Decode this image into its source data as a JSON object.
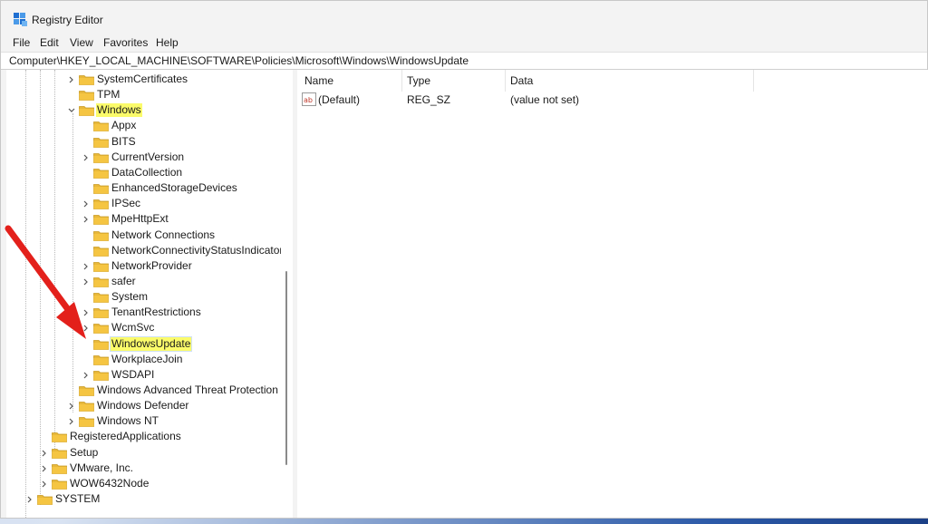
{
  "window": {
    "title": "Registry Editor"
  },
  "menu": [
    "File",
    "Edit",
    "View",
    "Favorites",
    "Help"
  ],
  "address": "Computer\\HKEY_LOCAL_MACHINE\\SOFTWARE\\Policies\\Microsoft\\Windows\\WindowsUpdate",
  "tree": [
    {
      "label": "SystemCertificates",
      "expander": "collapsed"
    },
    {
      "label": "TPM",
      "expander": "none"
    },
    {
      "label": "Windows",
      "expander": "expanded",
      "highlight": true
    },
    {
      "label": "Appx",
      "expander": "none"
    },
    {
      "label": "BITS",
      "expander": "none"
    },
    {
      "label": "CurrentVersion",
      "expander": "collapsed"
    },
    {
      "label": "DataCollection",
      "expander": "none"
    },
    {
      "label": "EnhancedStorageDevices",
      "expander": "none"
    },
    {
      "label": "IPSec",
      "expander": "collapsed"
    },
    {
      "label": "MpeHttpExt",
      "expander": "collapsed"
    },
    {
      "label": "Network Connections",
      "expander": "none"
    },
    {
      "label": "NetworkConnectivityStatusIndicator",
      "expander": "none"
    },
    {
      "label": "NetworkProvider",
      "expander": "collapsed"
    },
    {
      "label": "safer",
      "expander": "collapsed"
    },
    {
      "label": "System",
      "expander": "none"
    },
    {
      "label": "TenantRestrictions",
      "expander": "collapsed"
    },
    {
      "label": "WcmSvc",
      "expander": "collapsed"
    },
    {
      "label": "WindowsUpdate",
      "expander": "none",
      "selected": true
    },
    {
      "label": "WorkplaceJoin",
      "expander": "none"
    },
    {
      "label": "WSDAPI",
      "expander": "collapsed"
    },
    {
      "label": "Windows Advanced Threat Protection",
      "expander": "none"
    },
    {
      "label": "Windows Defender",
      "expander": "collapsed"
    },
    {
      "label": "Windows NT",
      "expander": "collapsed"
    },
    {
      "label": "RegisteredApplications",
      "expander": "none"
    },
    {
      "label": "Setup",
      "expander": "collapsed"
    },
    {
      "label": "VMware, Inc.",
      "expander": "collapsed"
    },
    {
      "label": "WOW6432Node",
      "expander": "collapsed"
    },
    {
      "label": "SYSTEM",
      "expander": "collapsed"
    }
  ],
  "values": {
    "columns": [
      "Name",
      "Type",
      "Data"
    ],
    "rows": [
      {
        "icon": "string-value-icon",
        "name": "(Default)",
        "type": "REG_SZ",
        "data": "(value not set)"
      }
    ]
  },
  "colors": {
    "highlight": "#fbfb6a",
    "folder": "#f5c542",
    "arrow": "#e3201b"
  }
}
